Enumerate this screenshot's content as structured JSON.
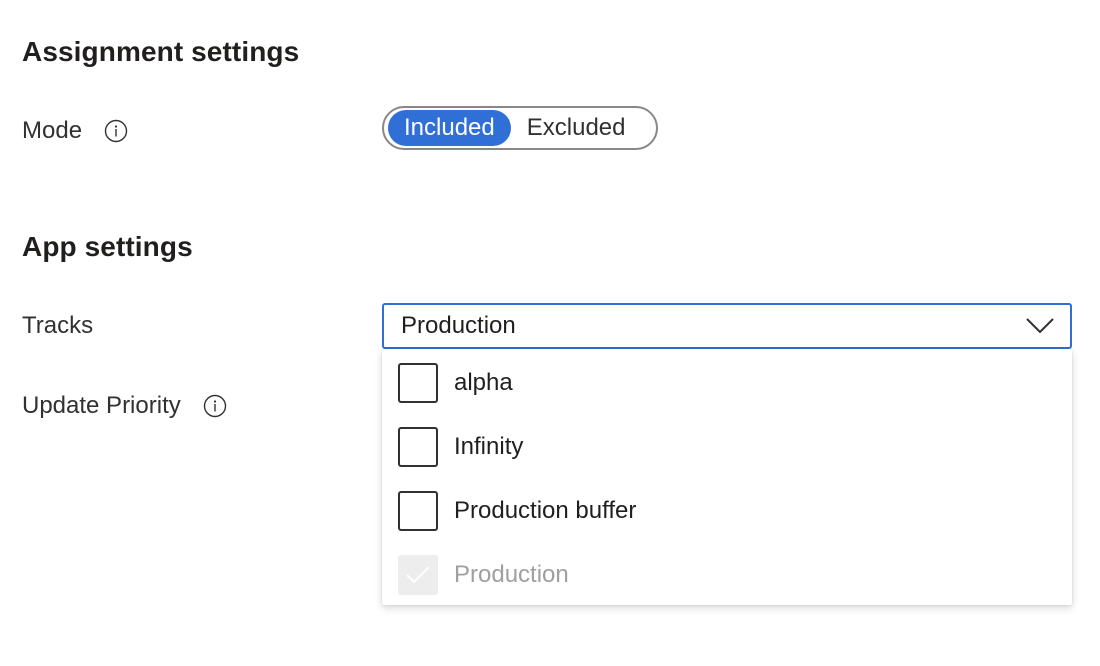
{
  "assignment": {
    "title": "Assignment settings",
    "mode_label": "Mode",
    "mode_options": [
      {
        "label": "Included",
        "selected": true
      },
      {
        "label": "Excluded",
        "selected": false
      }
    ]
  },
  "app": {
    "title": "App settings",
    "tracks_label": "Tracks",
    "update_priority_label": "Update Priority",
    "tracks_dropdown": {
      "value": "Production",
      "options": [
        {
          "label": "alpha",
          "checked": false,
          "disabled": false
        },
        {
          "label": "Infinity",
          "checked": false,
          "disabled": false
        },
        {
          "label": "Production buffer",
          "checked": false,
          "disabled": false
        },
        {
          "label": "Production",
          "checked": true,
          "disabled": true
        }
      ]
    }
  },
  "colors": {
    "accent": "#2f6fd6",
    "disabled_text": "#a19f9d",
    "disabled_fill": "#ededed"
  },
  "icons": {
    "info": "info-icon",
    "chevron": "chevron-down-icon",
    "check": "checkmark-icon"
  }
}
